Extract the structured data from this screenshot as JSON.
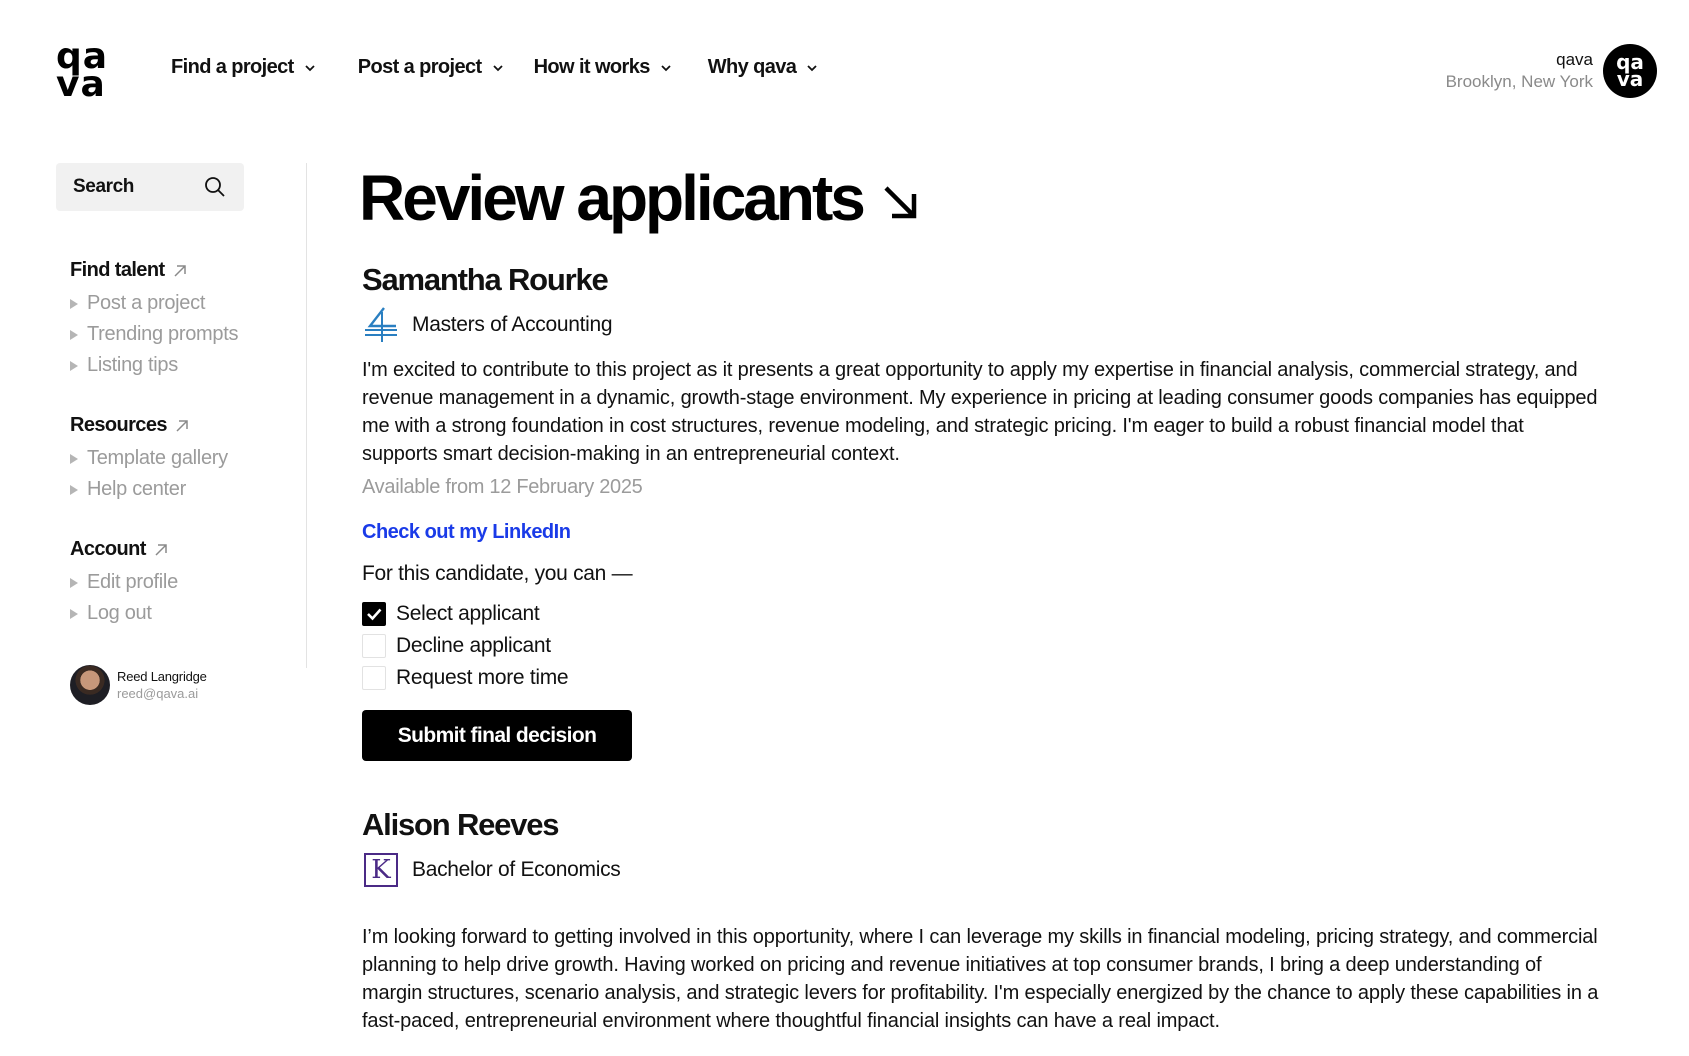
{
  "brand": {
    "logo_line1": "qa",
    "logo_line2": "va"
  },
  "nav": [
    {
      "label": "Find a project"
    },
    {
      "label": "Post a project"
    },
    {
      "label": "How it works"
    },
    {
      "label": "Why qava"
    }
  ],
  "account_top": {
    "name": "qava",
    "location": "Brooklyn, New York",
    "logo_line1": "qa",
    "logo_line2": "va"
  },
  "sidebar": {
    "search_label": "Search",
    "sections": [
      {
        "title": "Find talent",
        "items": [
          "Post a project",
          "Trending prompts",
          "Listing tips"
        ]
      },
      {
        "title": "Resources",
        "items": [
          "Template gallery",
          "Help center"
        ]
      },
      {
        "title": "Account",
        "items": [
          "Edit profile",
          "Log out"
        ]
      }
    ],
    "user": {
      "name": "Reed Langridge",
      "email": "reed@qava.ai"
    }
  },
  "main": {
    "title": "Review applicants",
    "applicants": [
      {
        "name": "Samantha Rourke",
        "degree": "Masters of Accounting",
        "bio": "I'm excited to contribute to this project as it presents a great opportunity to apply my expertise in financial analysis, commercial strategy, and revenue management in a dynamic, growth-stage environment. My experience in pricing at leading consumer goods companies has equipped me with a strong foundation in cost structures, revenue modeling, and strategic pricing. I'm eager to build a robust financial model that supports smart decision-making in an entrepreneurial context.",
        "availability": "Available from 12 February 2025",
        "link": "Check out my LinkedIn",
        "options_intro": "For this candidate, you can —",
        "options": [
          {
            "label": "Select applicant",
            "checked": true
          },
          {
            "label": "Decline applicant",
            "checked": false
          },
          {
            "label": "Request more time",
            "checked": false
          }
        ],
        "submit": "Submit final decision"
      },
      {
        "name": "Alison Reeves",
        "degree": "Bachelor of Economics",
        "badge_letter": "K",
        "bio": "I’m looking forward to getting involved in this opportunity, where I can leverage my skills in financial modeling, pricing strategy, and commercial planning to help drive growth. Having worked on pricing and revenue initiatives at top consumer brands, I bring a deep understanding of margin structures, scenario analysis, and strategic levers for profitability. I'm especially energized by the chance to apply these capabilities in a fast-paced, entrepreneurial environment where thoughtful financial insights can have a real impact."
      }
    ]
  },
  "colors": {
    "link": "#1a3be8",
    "muted": "#9b9b9b",
    "primary": "#000000",
    "k_badge": "#4b2a86",
    "accounting_badge": "#2a7fc1"
  }
}
